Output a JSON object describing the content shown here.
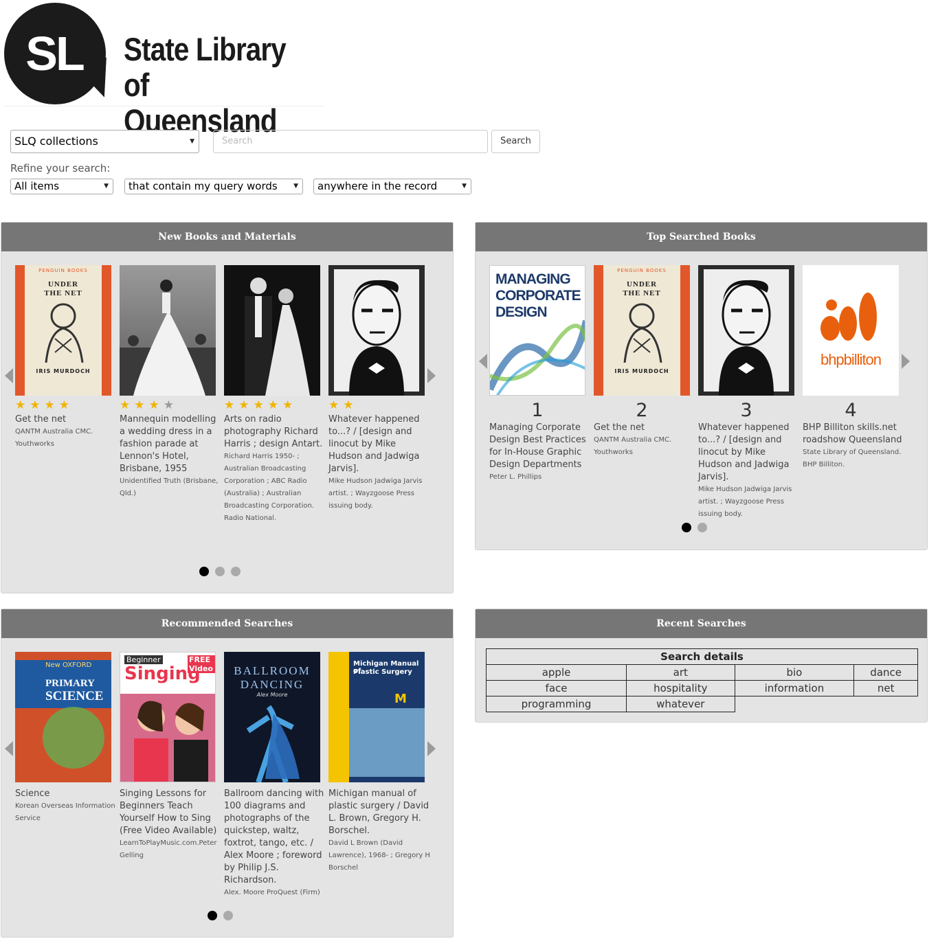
{
  "logo": {
    "mark": "SL",
    "line1": "State Library",
    "line2": "of Queensland"
  },
  "search": {
    "collection": "SLQ collections",
    "placeholder": "Search",
    "button": "Search",
    "refine_label": "Refine your search:",
    "filters": [
      "All items",
      "that contain my query words",
      "anywhere in the record"
    ]
  },
  "new_books": {
    "title": "New Books and Materials",
    "items": [
      {
        "stars": 4,
        "title": "Get the net",
        "author": "QANTM Australia CMC. Youthworks",
        "cover": "under-the-net"
      },
      {
        "stars": 3.5,
        "title": "Mannequin modelling a wedding dress in a fashion parade at Lennon's Hotel, Brisbane, 1955",
        "author": "Unidentified Truth (Brisbane, Qld.)",
        "cover": "wedding-dress"
      },
      {
        "stars": 5,
        "title": "Arts on radio photography Richard Harris ; design Antart.",
        "author": "Richard Harris 1950- ; Australian Broadcasting Corporation ; ABC Radio (Australia) ; Australian Broadcasting Corporation. Radio National.",
        "cover": "wedding-couple"
      },
      {
        "stars": 2,
        "title": "Whatever happened to...? / [design and linocut by Mike Hudson and Jadwiga Jarvis].",
        "author": "Mike Hudson Jadwiga Jarvis artist. ; Wayzgoose Press issuing body.",
        "cover": "linocut-face"
      }
    ],
    "dots": 3,
    "active_dot": 0
  },
  "top_books": {
    "title": "Top Searched Books",
    "items": [
      {
        "rank": "1",
        "title": "Managing Corporate Design Best Practices for In-House Graphic Design Departments",
        "author": "Peter L. Phillips",
        "cover": "managing-corporate-design",
        "cover_text": [
          "MANAGING",
          "CORPORATE",
          "DESIGN"
        ]
      },
      {
        "rank": "2",
        "title": "Get the net",
        "author": "QANTM Australia CMC. Youthworks",
        "cover": "under-the-net"
      },
      {
        "rank": "3",
        "title": "Whatever happened to...? / [design and linocut by Mike Hudson and Jadwiga Jarvis].",
        "author": "Mike Hudson Jadwiga Jarvis artist. ; Wayzgoose Press issuing body.",
        "cover": "linocut-face"
      },
      {
        "rank": "4",
        "title": "BHP Billiton skills.net roadshow Queensland",
        "author": "State Library of Queensland. BHP Billiton.",
        "cover": "bhp-billiton",
        "cover_text": [
          "bhpbilliton"
        ]
      }
    ],
    "dots": 2,
    "active_dot": 0
  },
  "penguin_cover": {
    "publisher": "PENGUIN BOOKS",
    "title_line1": "UNDER",
    "title_line2": "THE NET",
    "author": "IRIS MURDOCH"
  },
  "recommended": {
    "title": "Recommended Searches",
    "items": [
      {
        "title": "Science",
        "author": "Korean Overseas Information Service",
        "cover": "oxford-primary-science",
        "cover_text": [
          "New OXFORD",
          "PRIMARY",
          "SCIENCE"
        ]
      },
      {
        "title": "Singing Lessons for Beginners Teach Yourself How to Sing (Free Video Available)",
        "author": "LearnToPlayMusic.com.Peter Gelling",
        "cover": "beginner-singing",
        "cover_text": [
          "Beginner",
          "Singing",
          "FREE Video"
        ]
      },
      {
        "title": "Ballroom dancing with 100 diagrams and photographs of the quickstep, waltz, foxtrot, tango, etc. / Alex Moore ; foreword by Philip J.S. Richardson.",
        "author": "Alex. Moore ProQuest (Firm)",
        "cover": "ballroom-dancing",
        "cover_text": [
          "BALLROOM",
          "DANCING",
          "Alex Moore"
        ]
      },
      {
        "title": "Michigan manual of plastic surgery / David L. Brown, Gregory H. Borschel.",
        "author": "David L Brown (David Lawrence), 1968- ; Gregory H Borschel",
        "cover": "michigan-manual",
        "cover_text": [
          "Michigan Manual of",
          "Plastic Surgery"
        ]
      }
    ],
    "dots": 2,
    "active_dot": 0
  },
  "recent": {
    "title": "Recent Searches",
    "header": "Search details",
    "terms": [
      "apple",
      "art",
      "bio",
      "dance",
      "face",
      "hospitality",
      "information",
      "net",
      "programming",
      "whatever"
    ]
  },
  "colors": {
    "panel_header": "#767676",
    "panel_bg": "#e4e4e4",
    "star": "#f0b400",
    "dot_active": "#000000",
    "dot": "#aaaaaa"
  }
}
